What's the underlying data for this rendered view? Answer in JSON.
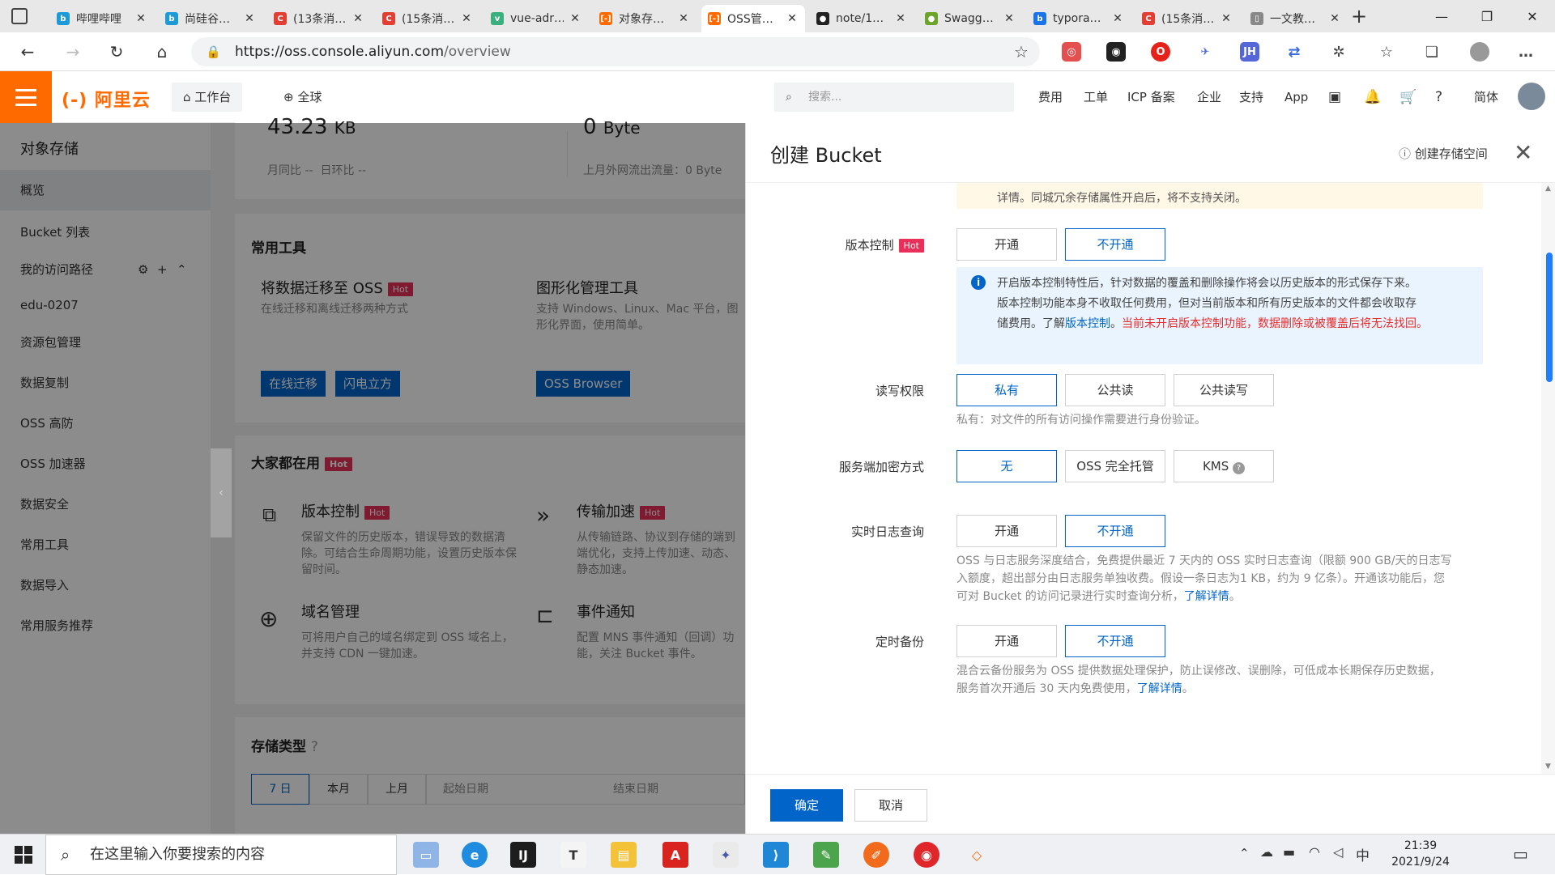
{
  "browser": {
    "tabs": [
      {
        "title": "哔哩哔哩",
        "icon": "bilibili-icon",
        "color": "#1e9bd7",
        "glyph": "b"
      },
      {
        "title": "尚硅谷…",
        "icon": "bilibili-icon",
        "color": "#1e9bd7",
        "glyph": "b"
      },
      {
        "title": "(13条消…",
        "icon": "csdn-icon",
        "color": "#e33e33",
        "glyph": "C"
      },
      {
        "title": "(15条消…",
        "icon": "csdn-icon",
        "color": "#e33e33",
        "glyph": "C"
      },
      {
        "title": "vue-adr…",
        "icon": "vue-icon",
        "color": "#3ab07f",
        "glyph": "v"
      },
      {
        "title": "对象存…",
        "icon": "aliyun-icon",
        "color": "#ff6a00",
        "glyph": "[-]"
      },
      {
        "title": "OSS管…",
        "icon": "aliyun-icon",
        "color": "#ff6a00",
        "glyph": "[-]"
      },
      {
        "title": "note/1…",
        "icon": "github-icon",
        "color": "#222222",
        "glyph": "●"
      },
      {
        "title": "Swagg…",
        "icon": "swagger-icon",
        "color": "#6ca32b",
        "glyph": "●"
      },
      {
        "title": "typora…",
        "icon": "bing-icon",
        "color": "#1a73e8",
        "glyph": "b"
      },
      {
        "title": "(15条消…",
        "icon": "csdn-icon",
        "color": "#e33e33",
        "glyph": "C"
      },
      {
        "title": "一文教…",
        "icon": "document-icon",
        "color": "#888888",
        "glyph": "▯"
      }
    ],
    "active_tab_index": 6,
    "url_host": "https://oss.console.aliyun.com",
    "url_path": "/overview"
  },
  "console": {
    "logo": "(-) 阿里云",
    "workbench": "工作台",
    "region": "全球",
    "search_placeholder": "搜索...",
    "top_links": [
      "费用",
      "工单",
      "ICP 备案",
      "企业",
      "支持",
      "App"
    ],
    "language": "简体"
  },
  "sidebar": {
    "title": "对象存储",
    "items": [
      "概览",
      "Bucket 列表",
      "我的访问路径",
      "edu-0207",
      "资源包管理",
      "数据复制",
      "OSS 高防",
      "OSS 加速器",
      "数据安全",
      "常用工具",
      "数据导入",
      "常用服务推荐"
    ],
    "selected_index": 0
  },
  "overview": {
    "stat1_value": "43.23",
    "stat1_unit": "KB",
    "stat1_mom": "月同比 --",
    "stat1_dod": "日环比 --",
    "stat2_value": "0",
    "stat2_unit": "Byte",
    "stat2_sub": "上月外网流出流量：0 Byte",
    "tools_title": "常用工具",
    "tool1_title": "将数据迁移至 OSS",
    "tool1_desc": "在线迁移和离线迁移两种方式",
    "tool1_btn1": "在线迁移",
    "tool1_btn2": "闪电立方",
    "tool2_title": "图形化管理工具",
    "tool2_desc": "支持 Windows、Linux、Mac 平台，图形化界面，使用简单。",
    "tool2_btn": "OSS Browser",
    "popular_title": "大家都在用",
    "hot": "Hot",
    "feat1_title": "版本控制",
    "feat1_desc": "保留文件的历史版本，错误导致的数据清除。可结合生命周期功能，设置历史版本保留时间。",
    "feat2_title": "传输加速",
    "feat2_desc": "从传输链路、协议到存储的端到端优化，支持上传加速、动态、静态加速。",
    "feat3_title": "域名管理",
    "feat3_desc": "可将用户自己的域名绑定到 OSS 域名上，并支持 CDN 一键加速。",
    "feat4_title": "事件通知",
    "feat4_desc": "配置 MNS 事件通知（回调）功能，关注 Bucket 事件。",
    "storage_title": "存储类型",
    "storage_tabs": [
      "7 日",
      "本月",
      "上月"
    ],
    "start_date": "起始日期",
    "end_date": "结束日期"
  },
  "drawer": {
    "title": "创建 Bucket",
    "help_link": "创建存储空间",
    "top_notice": "详情。同城冗余存储属性开启后，将不支持关闭。",
    "top_notice_link": "详情",
    "versioning_label": "版本控制",
    "versioning_hot": "Hot",
    "on": "开通",
    "off": "不开通",
    "versioning_info_1": "开启版本控制特性后，针对数据的覆盖和删除操作将会以历史版本的形式保存下来。",
    "versioning_info_2": "版本控制功能本身不收取任何费用，但对当前版本和所有历史版本的文件都会收取存",
    "versioning_info_3a": "储费用。了解",
    "versioning_info_link": "版本控制",
    "versioning_info_3b": "。",
    "versioning_warn": "当前未开启版本控制功能，数据删除或被覆盖后将无法找回。",
    "acl_label": "读写权限",
    "acl_options": [
      "私有",
      "公共读",
      "公共读写"
    ],
    "acl_hint": "私有：对文件的所有访问操作需要进行身份验证。",
    "encryption_label": "服务端加密方式",
    "encryption_options": [
      "无",
      "OSS 完全托管",
      "KMS"
    ],
    "log_label": "实时日志查询",
    "log_hint_1": "OSS 与日志服务深度结合，免费提供最近 7 天内的 OSS 实时日志查询（限额 900 GB/天的日志写",
    "log_hint_2": "入额度，超出部分由日志服务单独收费。假设一条日志为1 KB，约为 9 亿条）。开通该功能后，您",
    "log_hint_3": "可对 Bucket 的访问记录进行实时查询分析，",
    "log_hint_link": "了解详情",
    "backup_label": "定时备份",
    "backup_hint_1": "混合云备份服务为 OSS 提供数据处理保护，防止误修改、误删除，可低成本长期保存历史数据，",
    "backup_hint_2": "服务首次开通后 30 天内免费使用，",
    "backup_hint_link": "了解详情",
    "confirm": "确定",
    "cancel": "取消"
  },
  "taskbar": {
    "search_placeholder": "在这里输入你要搜索的内容",
    "ime": "中",
    "time": "21:39",
    "date": "2021/9/24"
  },
  "colors": {
    "brand": "#ff6a00",
    "primary": "#0064c8",
    "hot": "#e8305a",
    "warn": "#e52c2c"
  }
}
